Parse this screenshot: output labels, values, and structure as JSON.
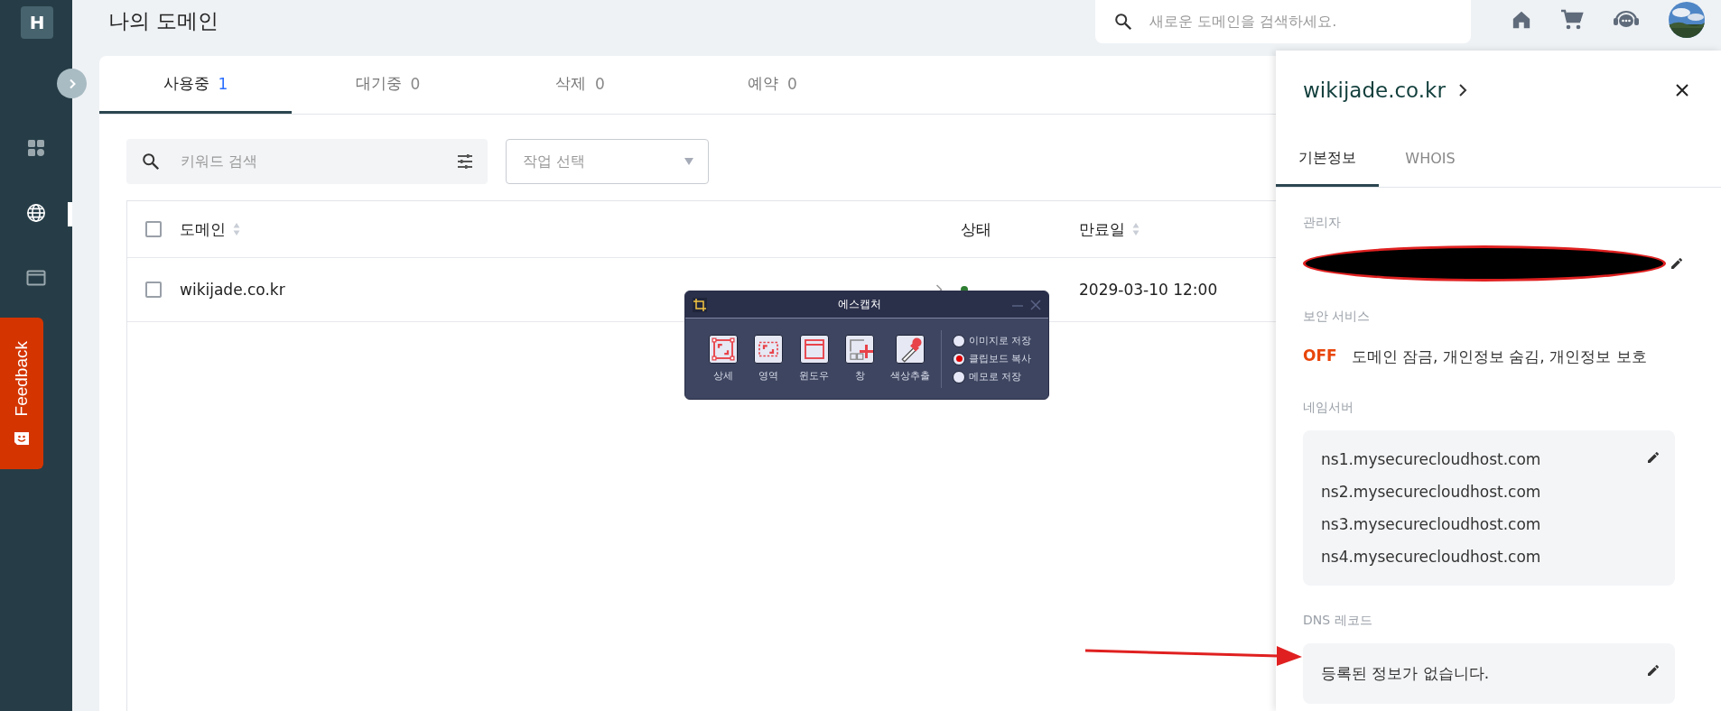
{
  "sidebar": {
    "logo": "H",
    "items": [
      {
        "kind": "dashboard",
        "selected": false
      },
      {
        "kind": "globe",
        "selected": true
      },
      {
        "kind": "window",
        "selected": false
      }
    ]
  },
  "feedback": {
    "label": "Feedback"
  },
  "header": {
    "title": "나의 도메인",
    "search": {
      "placeholder": "새로운 도메인을 검색하세요."
    }
  },
  "tabs": [
    {
      "label": "사용중",
      "count": "1",
      "selected": true
    },
    {
      "label": "대기중",
      "count": "0",
      "selected": false
    },
    {
      "label": "삭제",
      "count": "0",
      "selected": false
    },
    {
      "label": "예약",
      "count": "0",
      "selected": false
    }
  ],
  "filter": {
    "search_placeholder": "키워드 검색",
    "action_placeholder": "작업 선택"
  },
  "table": {
    "all_checked": false,
    "columns": [
      {
        "label": "도메인",
        "sortable": true
      },
      {
        "label": "상태",
        "sortable": false
      },
      {
        "label": "만료일",
        "sortable": true
      }
    ],
    "rows": [
      {
        "domain": "wikijade.co.kr",
        "checked": false,
        "color": "#2e7d32",
        "expires": "2029-03-10 12:00"
      }
    ]
  },
  "detail": {
    "domain": "wikijade.co.kr",
    "tabs": [
      {
        "label": "기본정보",
        "selected": true
      },
      {
        "label": "WHOIS",
        "selected": false
      }
    ],
    "sections": [
      {
        "kind": "redacted",
        "label": "관리자"
      },
      {
        "kind": "security",
        "label": "보안 서비스",
        "status": "OFF",
        "text": "도메인 잠금, 개인정보 숨김, 개인정보 보호"
      },
      {
        "kind": "list",
        "label": "네임서버",
        "items": [
          "ns1.mysecurecloudhost.com",
          "ns2.mysecurecloudhost.com",
          "ns3.mysecurecloudhost.com",
          "ns4.mysecurecloudhost.com"
        ]
      },
      {
        "kind": "list",
        "label": "DNS 레코드",
        "items": [
          "등록된 정보가 없습니다."
        ]
      }
    ]
  },
  "capture": {
    "title": "에스캡처",
    "tools": [
      {
        "kind": "detail",
        "label": "상세"
      },
      {
        "kind": "region",
        "label": "영역"
      },
      {
        "kind": "window",
        "label": "윈도우"
      },
      {
        "kind": "pane",
        "label": "창"
      },
      {
        "kind": "picker",
        "label": "색상추출"
      }
    ],
    "options": [
      {
        "label": "이미지로 저장",
        "selected": false
      },
      {
        "label": "클립보드 복사",
        "selected": true
      },
      {
        "label": "메모로 저장",
        "selected": false
      }
    ]
  }
}
